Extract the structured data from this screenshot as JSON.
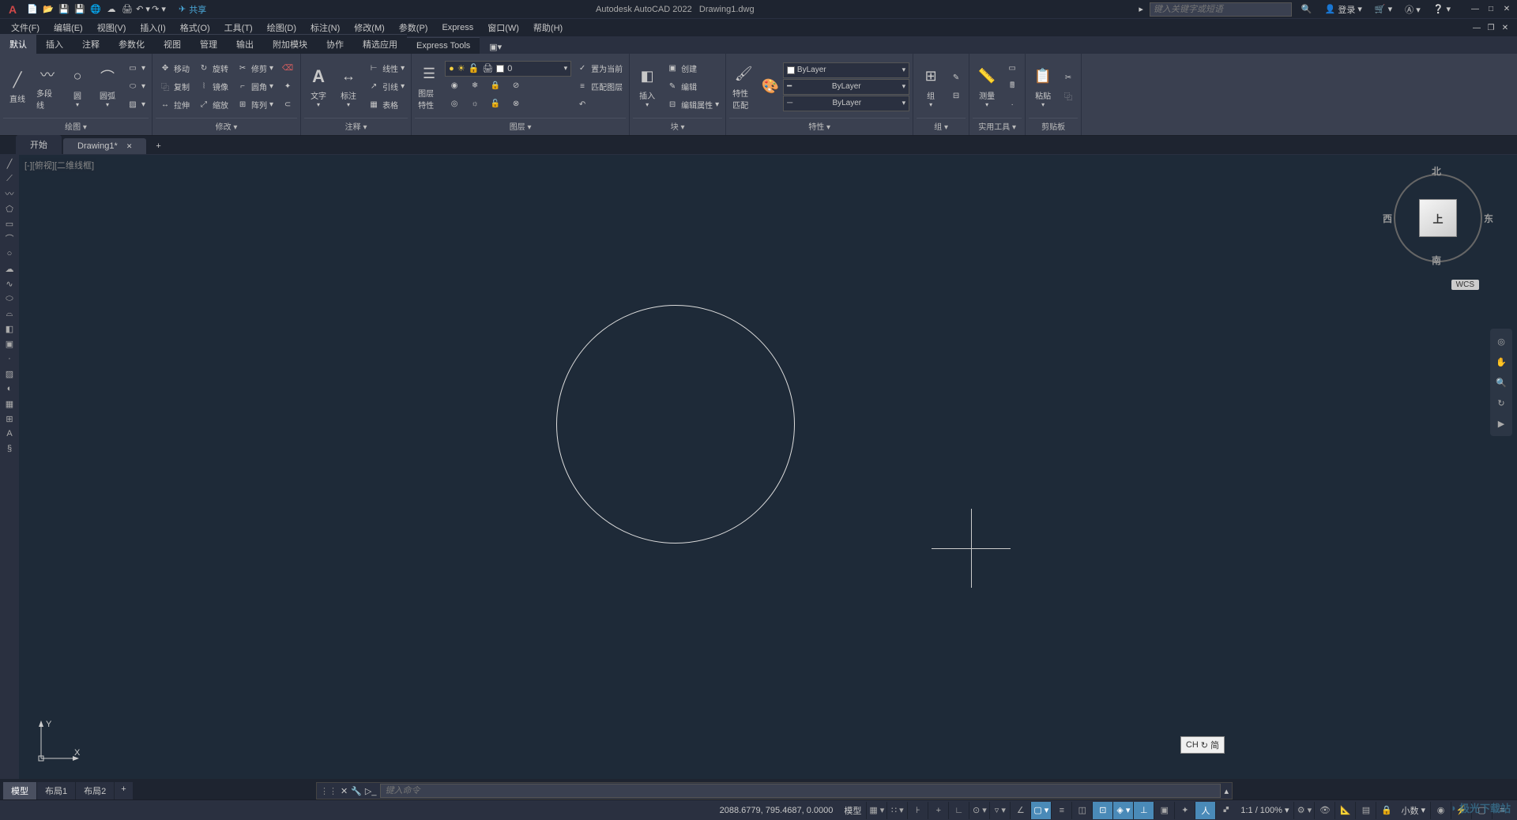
{
  "app": {
    "title": "Autodesk AutoCAD 2022",
    "filename": "Drawing1.dwg",
    "search_placeholder": "键入关键字或短语",
    "login": "登录",
    "share": "共享"
  },
  "menu": [
    "文件(F)",
    "编辑(E)",
    "视图(V)",
    "插入(I)",
    "格式(O)",
    "工具(T)",
    "绘图(D)",
    "标注(N)",
    "修改(M)",
    "参数(P)",
    "Express",
    "窗口(W)",
    "帮助(H)"
  ],
  "ribbon_tabs": [
    "默认",
    "插入",
    "注释",
    "参数化",
    "视图",
    "管理",
    "输出",
    "附加模块",
    "协作",
    "精选应用",
    "Express Tools"
  ],
  "panels": {
    "draw": {
      "title": "绘图 ▾",
      "line": "直线",
      "polyline": "多段线",
      "circle": "圆",
      "arc": "圆弧"
    },
    "modify": {
      "title": "修改 ▾",
      "move": "移动",
      "rotate": "旋转",
      "trim": "修剪",
      "copy": "复制",
      "mirror": "镜像",
      "fillet": "圆角",
      "stretch": "拉伸",
      "scale": "缩放",
      "array": "阵列"
    },
    "annotation": {
      "title": "注释 ▾",
      "text": "文字",
      "dimension": "标注",
      "table": "表格",
      "linear": "线性",
      "leader": "引线"
    },
    "layers": {
      "title": "图层 ▾",
      "props": "图层特性",
      "current": "0",
      "setcurrent": "置为当前",
      "match": "匹配图层"
    },
    "block": {
      "title": "块 ▾",
      "insert": "插入",
      "create": "创建",
      "edit": "编辑",
      "edit_attr": "编辑属性"
    },
    "properties": {
      "title": "特性 ▾",
      "match": "特性匹配",
      "layer": "ByLayer",
      "linetype": "ByLayer",
      "lineweight": "ByLayer"
    },
    "groups": {
      "title": "组 ▾",
      "group": "组"
    },
    "utilities": {
      "title": "实用工具 ▾",
      "measure": "测量"
    },
    "clipboard": {
      "title": "剪贴板",
      "paste": "粘贴"
    }
  },
  "filetabs": {
    "start": "开始",
    "drawing": "Drawing1*"
  },
  "viewport": {
    "label": "[-][俯视][二维线框]",
    "north": "北",
    "south": "南",
    "east": "东",
    "west": "西",
    "top": "上",
    "wcs": "WCS",
    "y": "Y",
    "x": "X"
  },
  "ime": {
    "lang": "CH",
    "mode": "简"
  },
  "command": {
    "prompt": "键入命令"
  },
  "layout_tabs": {
    "model": "模型",
    "layout1": "布局1",
    "layout2": "布局2"
  },
  "status": {
    "coords": "2088.6779, 795.4687, 0.0000",
    "model": "模型",
    "scale": "1:1 / 100%",
    "decimal": "小数"
  },
  "watermark": "极光下载站"
}
